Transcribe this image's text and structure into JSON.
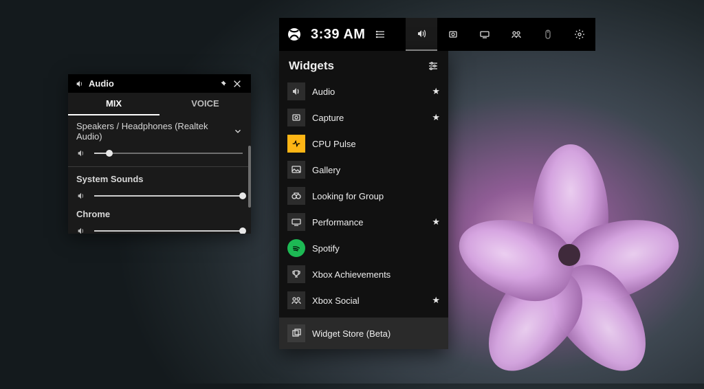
{
  "audio_widget": {
    "title": "Audio",
    "tabs": {
      "mix": "MIX",
      "voice": "VOICE"
    },
    "device_label": "Speakers / Headphones (Realtek Audio)",
    "device_volume_percent": 10,
    "apps": [
      {
        "name": "System Sounds",
        "volume_percent": 100
      },
      {
        "name": "Chrome",
        "volume_percent": 100
      }
    ]
  },
  "topbar": {
    "time": "3:39 AM"
  },
  "widgets_panel": {
    "title": "Widgets",
    "items": [
      {
        "label": "Audio",
        "icon": "volume",
        "favorite": true
      },
      {
        "label": "Capture",
        "icon": "capture",
        "favorite": true
      },
      {
        "label": "CPU Pulse",
        "icon": "cpu",
        "favorite": false
      },
      {
        "label": "Gallery",
        "icon": "gallery",
        "favorite": false
      },
      {
        "label": "Looking for Group",
        "icon": "lfg",
        "favorite": false
      },
      {
        "label": "Performance",
        "icon": "performance",
        "favorite": true
      },
      {
        "label": "Spotify",
        "icon": "spotify",
        "favorite": false
      },
      {
        "label": "Xbox Achievements",
        "icon": "trophy",
        "favorite": false
      },
      {
        "label": "Xbox Social",
        "icon": "social",
        "favorite": true
      }
    ],
    "store_label": "Widget Store (Beta)"
  }
}
